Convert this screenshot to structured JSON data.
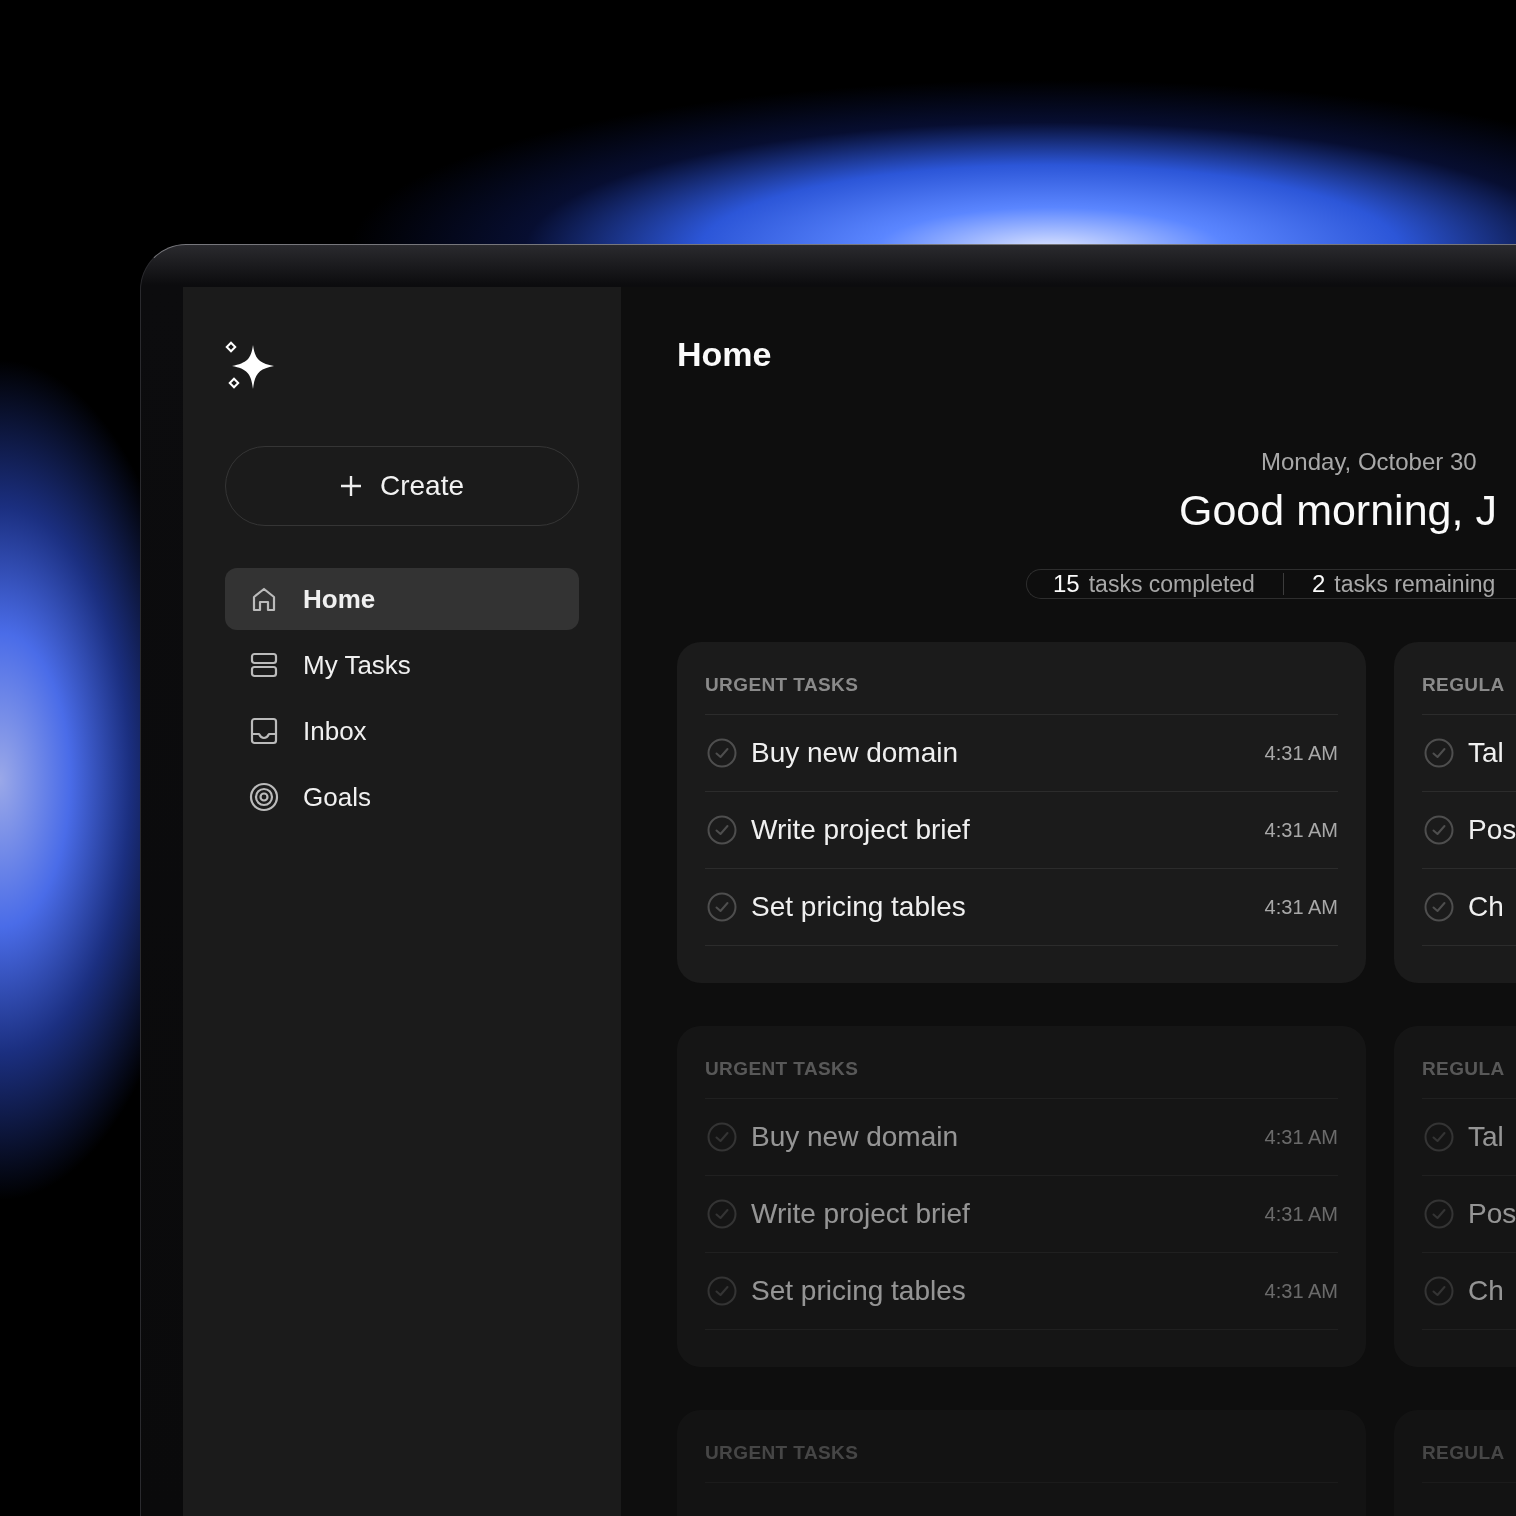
{
  "sidebar": {
    "create_button": {
      "label": "Create"
    },
    "nav": [
      {
        "label": "Home",
        "kind": "home",
        "selected": true
      },
      {
        "label": "My Tasks",
        "kind": "tasks",
        "selected": false
      },
      {
        "label": "Inbox",
        "kind": "inbox",
        "selected": false
      },
      {
        "label": "Goals",
        "kind": "goals",
        "selected": false
      }
    ]
  },
  "page_title": "Home",
  "date": "Monday, October 30",
  "greeting": "Good morning, J",
  "stats": [
    {
      "count": "15",
      "label": "tasks completed"
    },
    {
      "count": "2",
      "label": "tasks remaining"
    }
  ],
  "card_rows": [
    [
      {
        "title": "URGENT TASKS",
        "tasks": [
          {
            "name": "Buy new domain",
            "time": "4:31 AM"
          },
          {
            "name": "Write project brief",
            "time": "4:31 AM"
          },
          {
            "name": "Set pricing tables",
            "time": "4:31 AM"
          }
        ]
      },
      {
        "title": "REGULA",
        "tasks": [
          {
            "name": "Tal"
          },
          {
            "name": "Pos"
          },
          {
            "name": "Ch"
          }
        ]
      }
    ],
    [
      {
        "title": "URGENT TASKS",
        "tasks": [
          {
            "name": "Buy new domain",
            "time": "4:31 AM"
          },
          {
            "name": "Write project brief",
            "time": "4:31 AM"
          },
          {
            "name": "Set pricing tables",
            "time": "4:31 AM"
          }
        ]
      },
      {
        "title": "REGULA",
        "tasks": [
          {
            "name": "Tal"
          },
          {
            "name": "Pos"
          },
          {
            "name": "Ch"
          }
        ]
      }
    ],
    [
      {
        "title": "URGENT TASKS"
      },
      {
        "title": "REGULA"
      }
    ]
  ]
}
